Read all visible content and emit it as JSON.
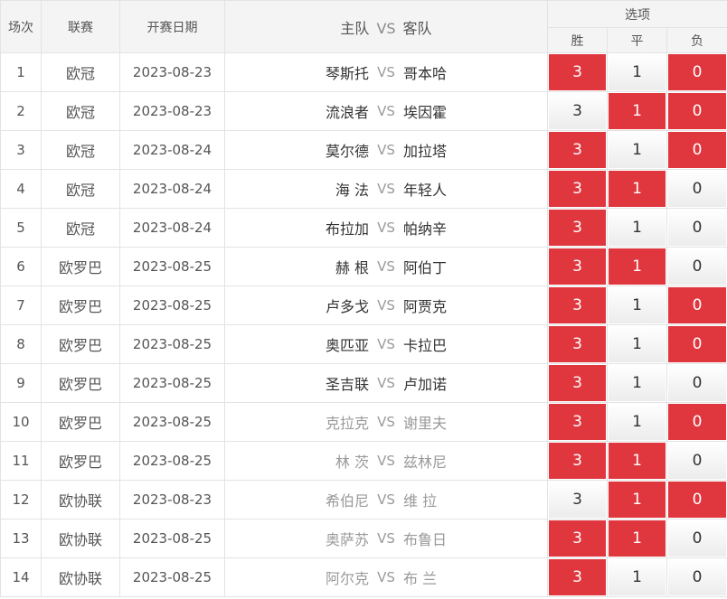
{
  "header": {
    "col_round": "场次",
    "col_league": "联赛",
    "col_date": "开赛日期",
    "col_home": "主队",
    "col_vs": "VS",
    "col_away": "客队",
    "col_options": "选项",
    "opt_win": "胜",
    "opt_draw": "平",
    "opt_lose": "负"
  },
  "colors": {
    "selected": "#e0373f",
    "header_bg": "#f4f4f4",
    "border": "#e3e3e3"
  },
  "rows": [
    {
      "no": "1",
      "league": "欧冠",
      "date": "2023-08-23",
      "home": "琴斯托",
      "vs": "VS",
      "away": "哥本哈",
      "w": "3",
      "d": "1",
      "l": "0"
    },
    {
      "no": "2",
      "league": "欧冠",
      "date": "2023-08-23",
      "home": "流浪者",
      "vs": "VS",
      "away": "埃因霍",
      "w": "3",
      "d": "1",
      "l": "0"
    },
    {
      "no": "3",
      "league": "欧冠",
      "date": "2023-08-24",
      "home": "莫尔德",
      "vs": "VS",
      "away": "加拉塔",
      "w": "3",
      "d": "1",
      "l": "0"
    },
    {
      "no": "4",
      "league": "欧冠",
      "date": "2023-08-24",
      "home": "海 法",
      "vs": "VS",
      "away": "年轻人",
      "w": "3",
      "d": "1",
      "l": "0"
    },
    {
      "no": "5",
      "league": "欧冠",
      "date": "2023-08-24",
      "home": "布拉加",
      "vs": "VS",
      "away": "帕纳辛",
      "w": "3",
      "d": "1",
      "l": "0"
    },
    {
      "no": "6",
      "league": "欧罗巴",
      "date": "2023-08-25",
      "home": "赫 根",
      "vs": "VS",
      "away": "阿伯丁",
      "w": "3",
      "d": "1",
      "l": "0"
    },
    {
      "no": "7",
      "league": "欧罗巴",
      "date": "2023-08-25",
      "home": "卢多戈",
      "vs": "VS",
      "away": "阿贾克",
      "w": "3",
      "d": "1",
      "l": "0"
    },
    {
      "no": "8",
      "league": "欧罗巴",
      "date": "2023-08-25",
      "home": "奥匹亚",
      "vs": "VS",
      "away": "卡拉巴",
      "w": "3",
      "d": "1",
      "l": "0"
    },
    {
      "no": "9",
      "league": "欧罗巴",
      "date": "2023-08-25",
      "home": "圣吉联",
      "vs": "VS",
      "away": "卢加诺",
      "w": "3",
      "d": "1",
      "l": "0"
    },
    {
      "no": "10",
      "league": "欧罗巴",
      "date": "2023-08-25",
      "home": "克拉克",
      "vs": "VS",
      "away": "谢里夫",
      "w": "3",
      "d": "1",
      "l": "0"
    },
    {
      "no": "11",
      "league": "欧罗巴",
      "date": "2023-08-25",
      "home": "林 茨",
      "vs": "VS",
      "away": "兹林尼",
      "w": "3",
      "d": "1",
      "l": "0"
    },
    {
      "no": "12",
      "league": "欧协联",
      "date": "2023-08-23",
      "home": "希伯尼",
      "vs": "VS",
      "away": "维 拉",
      "w": "3",
      "d": "1",
      "l": "0"
    },
    {
      "no": "13",
      "league": "欧协联",
      "date": "2023-08-25",
      "home": "奥萨苏",
      "vs": "VS",
      "away": "布鲁日",
      "w": "3",
      "d": "1",
      "l": "0"
    },
    {
      "no": "14",
      "league": "欧协联",
      "date": "2023-08-25",
      "home": "阿尔克",
      "vs": "VS",
      "away": "布 兰",
      "w": "3",
      "d": "1",
      "l": "0"
    }
  ],
  "row_state": [
    {
      "dim": false,
      "sel": [
        true,
        false,
        true
      ]
    },
    {
      "dim": false,
      "sel": [
        false,
        true,
        true
      ]
    },
    {
      "dim": false,
      "sel": [
        true,
        false,
        true
      ]
    },
    {
      "dim": false,
      "sel": [
        true,
        true,
        false
      ]
    },
    {
      "dim": false,
      "sel": [
        true,
        false,
        false
      ]
    },
    {
      "dim": false,
      "sel": [
        true,
        true,
        false
      ]
    },
    {
      "dim": false,
      "sel": [
        true,
        false,
        true
      ]
    },
    {
      "dim": false,
      "sel": [
        true,
        false,
        true
      ]
    },
    {
      "dim": false,
      "sel": [
        true,
        false,
        false
      ]
    },
    {
      "dim": true,
      "sel": [
        true,
        false,
        true
      ]
    },
    {
      "dim": true,
      "sel": [
        true,
        true,
        false
      ]
    },
    {
      "dim": true,
      "sel": [
        false,
        true,
        true
      ]
    },
    {
      "dim": true,
      "sel": [
        true,
        true,
        false
      ]
    },
    {
      "dim": true,
      "sel": [
        true,
        false,
        false
      ]
    }
  ]
}
